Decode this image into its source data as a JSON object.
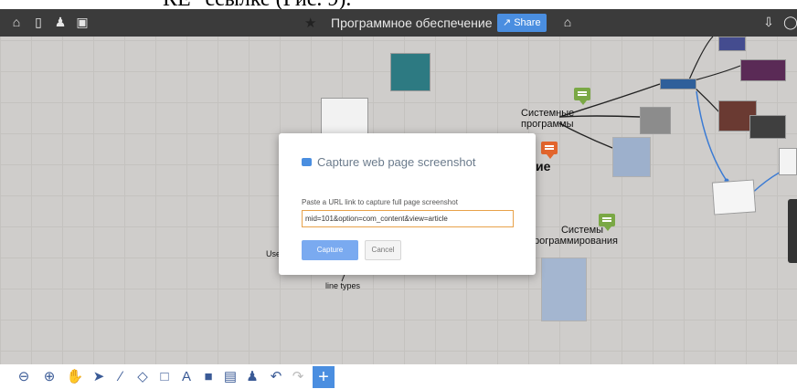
{
  "doc_text": "КЕ\" ссылке (Рис. 9).",
  "app": {
    "title": "Программное обеспечение",
    "share_label": "Share",
    "icons_left": [
      "home-icon",
      "panel-icon",
      "users-icon",
      "gallery-icon"
    ],
    "icons_right": [
      "download-icon",
      "comment-icon"
    ]
  },
  "map": {
    "node_system_programs": "Системные\nпрограммы",
    "node_system_programs_1": "Системные",
    "node_system_programs_2": "программы",
    "node_partial_1": "ие",
    "node_prog_systems_1": "Системы",
    "node_prog_systems_2": "рограммирования",
    "node_use": "Use",
    "node_line_types": "line types"
  },
  "modal": {
    "title": "Capture web page screenshot",
    "label": "Paste a URL link to capture full page screenshot",
    "input_value": "mid=101&option=com_content&view=article",
    "capture_label": "Capture",
    "cancel_label": "Cancel"
  },
  "toolbar": {
    "tools": [
      "zoom-out-icon",
      "zoom-in-icon",
      "hand-icon",
      "pointer-icon",
      "pencil-icon",
      "eraser-icon",
      "rectangle-icon",
      "text-icon",
      "sticker-icon",
      "comment-icon",
      "user-icon",
      "undo-icon",
      "redo-icon",
      "add-icon"
    ]
  },
  "colors": {
    "topbar": "#3b3b3b",
    "canvas": "#cfcdcb",
    "accent": "#4a8ee0",
    "input_border": "#e8a24a"
  }
}
